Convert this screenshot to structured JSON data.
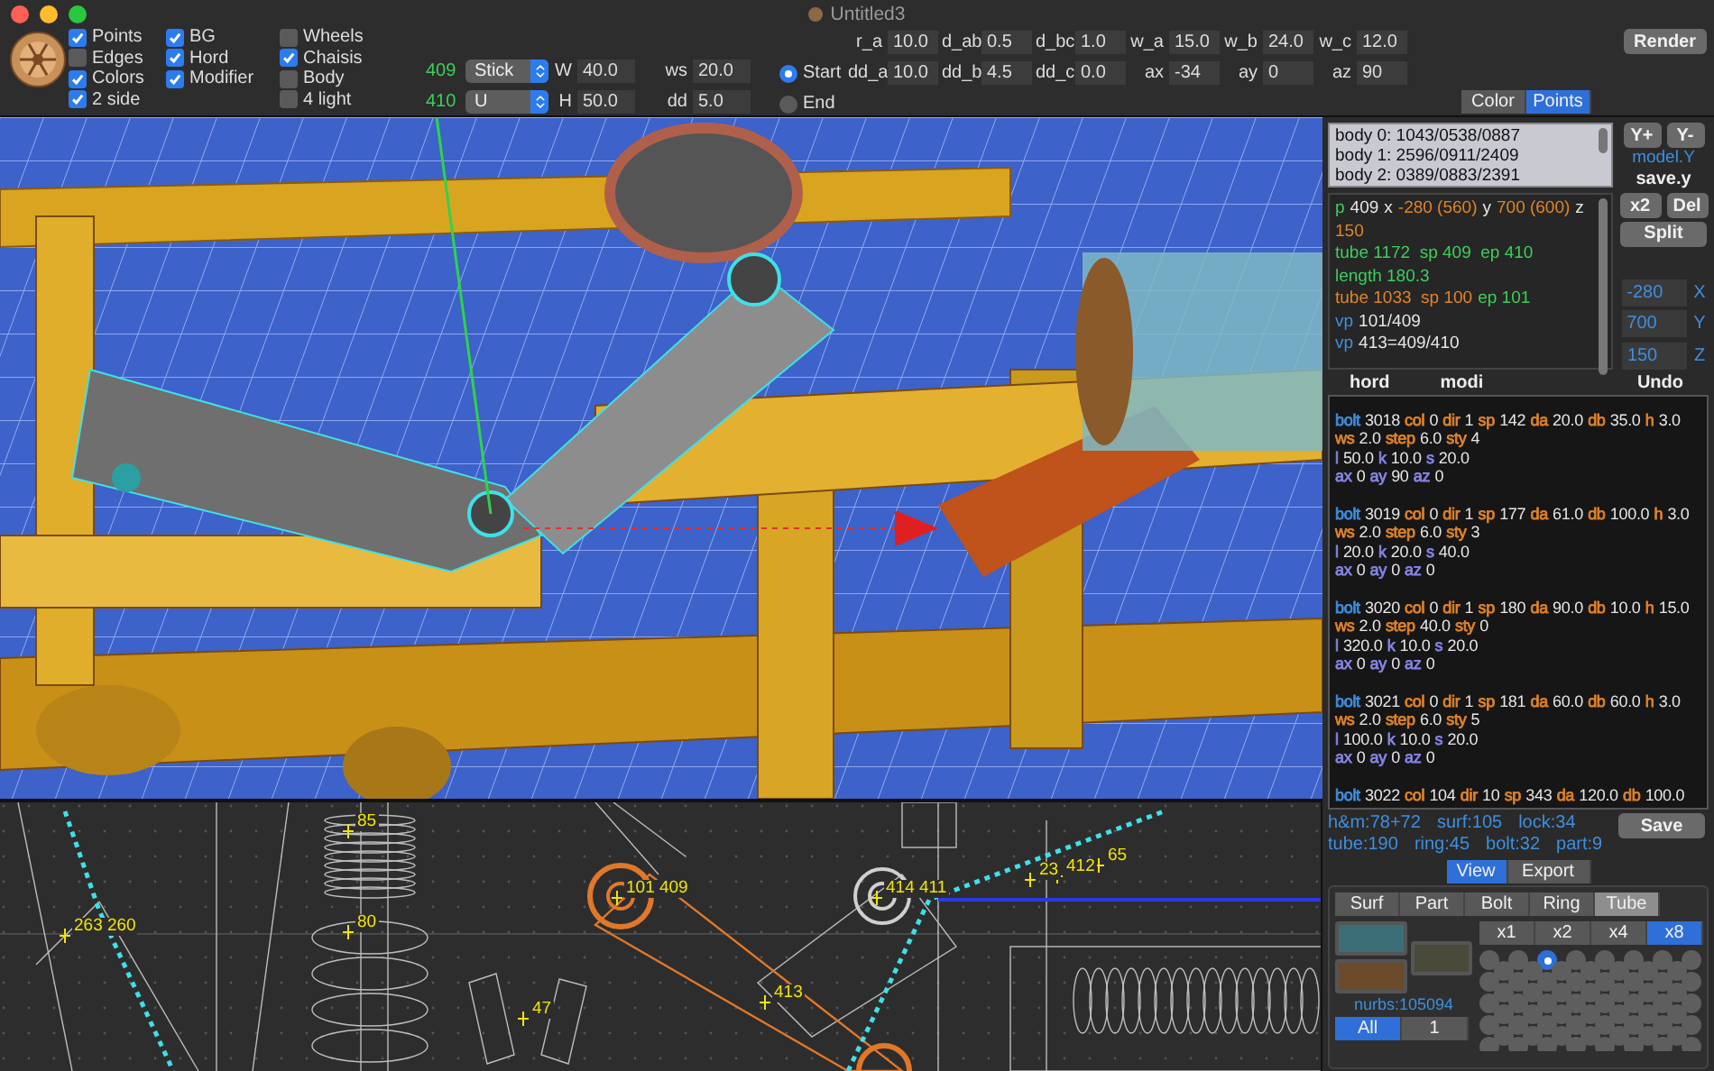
{
  "window": {
    "title": "Untitled3"
  },
  "toolbar": {
    "checkbox_columns": [
      [
        {
          "label": "Points",
          "checked": true
        },
        {
          "label": "Edges",
          "checked": false
        },
        {
          "label": "Colors",
          "checked": true
        },
        {
          "label": "2 side",
          "checked": true
        }
      ],
      [
        {
          "label": "BG",
          "checked": true
        },
        {
          "label": "Hord",
          "checked": true
        },
        {
          "label": "Modifier",
          "checked": true
        }
      ],
      [
        {
          "label": "Wheels",
          "checked": false
        },
        {
          "label": "Chaisis",
          "checked": true
        },
        {
          "label": "Body",
          "checked": false
        },
        {
          "label": "4 light",
          "checked": false
        }
      ]
    ],
    "element_rows": [
      {
        "id": "409",
        "type": "Stick",
        "dim_label": "W",
        "dim_value": "40.0",
        "extra_label": "ws",
        "extra_value": "20.0"
      },
      {
        "id": "410",
        "type": "U",
        "dim_label": "H",
        "dim_value": "50.0",
        "extra_label": "dd",
        "extra_value": "5.0"
      }
    ],
    "radios": [
      {
        "label": "Start",
        "selected": true
      },
      {
        "label": "End",
        "selected": false
      }
    ],
    "param_rows": [
      [
        {
          "label": "r_a",
          "value": "10.0"
        },
        {
          "label": "d_ab",
          "value": "0.5"
        },
        {
          "label": "d_bc",
          "value": "1.0"
        },
        {
          "label": "w_a",
          "value": "15.0"
        },
        {
          "label": "w_b",
          "value": "24.0"
        },
        {
          "label": "w_c",
          "value": "12.0"
        }
      ],
      [
        {
          "label": "dd_a",
          "value": "10.0"
        },
        {
          "label": "dd_b",
          "value": "4.5"
        },
        {
          "label": "dd_c",
          "value": "0.0"
        },
        {
          "label": "ax",
          "value": "-34"
        },
        {
          "label": "ay",
          "value": "0"
        },
        {
          "label": "az",
          "value": "90"
        }
      ]
    ],
    "render_button": "Render"
  },
  "wireframe": {
    "labels": [
      "263 260",
      "85",
      "80",
      "47",
      "101 409",
      "413",
      "414 411",
      "23",
      "412",
      "65"
    ]
  },
  "side_panel": {
    "mode_tabs": [
      {
        "label": "Color",
        "selected": false
      },
      {
        "label": "Points",
        "selected": true
      }
    ],
    "body_list": [
      "body 0: 1043/0538/0887",
      "body 1: 2596/0911/2409",
      "body 2: 0389/0883/2391"
    ],
    "y_buttons": [
      "Y+",
      "Y-"
    ],
    "model_link": "model.Y",
    "save_label": "save.y",
    "info_lines": [
      [
        {
          "t": "p",
          "color": "#3ccf5a"
        },
        {
          "t": "409",
          "color": "#e6e6e6"
        },
        {
          "t": "x",
          "color": "#e6e6e6"
        },
        {
          "t": "-280 (560)",
          "color": "#e0832a"
        },
        {
          "t": "y",
          "color": "#e6e6e6"
        },
        {
          "t": "700 (600)",
          "color": "#e0832a"
        },
        {
          "t": "z",
          "color": "#e6e6e6"
        }
      ],
      [
        {
          "t": "150",
          "color": "#e0832a"
        }
      ],
      [
        {
          "t": "tube 1172  sp 409  ep 410",
          "color": "#3ccf5a"
        }
      ],
      [
        {
          "t": "length 180.3",
          "color": "#3ccf5a"
        }
      ],
      [
        {
          "t": "tube 1033  sp 100",
          "color": "#e0832a"
        },
        {
          "t": "ep 101",
          "color": "#3ccf5a"
        }
      ],
      [
        {
          "t": "vp",
          "color": "#3d8fe0"
        },
        {
          "t": "101/409",
          "color": "#e6e6e6"
        }
      ],
      [
        {
          "t": "vp",
          "color": "#3d8fe0"
        },
        {
          "t": "413=409/410",
          "color": "#e6e6e6"
        }
      ]
    ],
    "edit_buttons": [
      "x2",
      "Del"
    ],
    "split_button": "Split",
    "coords": [
      {
        "value": "-280",
        "axis": "X"
      },
      {
        "value": "700",
        "axis": "Y"
      },
      {
        "value": "150",
        "axis": "Z"
      }
    ],
    "column_labels": [
      "hord",
      "modi"
    ],
    "undo_button": "Undo",
    "bolt_log": [
      [
        [
          {
            "key": "bolt",
            "value": "3018",
            "color": "#3d8fe0"
          },
          {
            "key": "col",
            "value": "0",
            "color": "#e0832a"
          },
          {
            "key": "dir",
            "value": "1",
            "color": "#e0832a"
          },
          {
            "key": "sp",
            "value": "142",
            "color": "#e0832a"
          },
          {
            "key": "da",
            "value": "20.0",
            "color": "#e0832a"
          },
          {
            "key": "db",
            "value": "35.0",
            "color": "#e0832a"
          },
          {
            "key": "h",
            "value": "3.0",
            "color": "#e0832a"
          }
        ],
        [
          {
            "key": "ws",
            "value": "2.0",
            "color": "#e0832a"
          },
          {
            "key": "step",
            "value": "6.0",
            "color": "#e0832a"
          },
          {
            "key": "sty",
            "value": "4",
            "color": "#e0832a"
          }
        ],
        [
          {
            "key": "l",
            "value": "50.0",
            "color": "#8585e6"
          },
          {
            "key": "k",
            "value": "10.0",
            "color": "#8585e6"
          },
          {
            "key": "s",
            "value": "20.0",
            "color": "#8585e6"
          }
        ],
        [
          {
            "key": "ax",
            "value": "0",
            "color": "#8585e6"
          },
          {
            "key": "ay",
            "value": "90",
            "color": "#8585e6"
          },
          {
            "key": "az",
            "value": "0",
            "color": "#8585e6"
          }
        ]
      ],
      [
        [
          {
            "key": "bolt",
            "value": "3019",
            "color": "#3d8fe0"
          },
          {
            "key": "col",
            "value": "0",
            "color": "#e0832a"
          },
          {
            "key": "dir",
            "value": "1",
            "color": "#e0832a"
          },
          {
            "key": "sp",
            "value": "177",
            "color": "#e0832a"
          },
          {
            "key": "da",
            "value": "61.0",
            "color": "#e0832a"
          },
          {
            "key": "db",
            "value": "100.0",
            "color": "#e0832a"
          },
          {
            "key": "h",
            "value": "3.0",
            "color": "#e0832a"
          }
        ],
        [
          {
            "key": "ws",
            "value": "2.0",
            "color": "#e0832a"
          },
          {
            "key": "step",
            "value": "6.0",
            "color": "#e0832a"
          },
          {
            "key": "sty",
            "value": "3",
            "color": "#e0832a"
          }
        ],
        [
          {
            "key": "l",
            "value": "20.0",
            "color": "#8585e6"
          },
          {
            "key": "k",
            "value": "20.0",
            "color": "#8585e6"
          },
          {
            "key": "s",
            "value": "40.0",
            "color": "#8585e6"
          }
        ],
        [
          {
            "key": "ax",
            "value": "0",
            "color": "#8585e6"
          },
          {
            "key": "ay",
            "value": "0",
            "color": "#8585e6"
          },
          {
            "key": "az",
            "value": "0",
            "color": "#8585e6"
          }
        ]
      ],
      [
        [
          {
            "key": "bolt",
            "value": "3020",
            "color": "#3d8fe0"
          },
          {
            "key": "col",
            "value": "0",
            "color": "#e0832a"
          },
          {
            "key": "dir",
            "value": "1",
            "color": "#e0832a"
          },
          {
            "key": "sp",
            "value": "180",
            "color": "#e0832a"
          },
          {
            "key": "da",
            "value": "90.0",
            "color": "#e0832a"
          },
          {
            "key": "db",
            "value": "10.0",
            "color": "#e0832a"
          },
          {
            "key": "h",
            "value": "15.0",
            "color": "#e0832a"
          }
        ],
        [
          {
            "key": "ws",
            "value": "2.0",
            "color": "#e0832a"
          },
          {
            "key": "step",
            "value": "40.0",
            "color": "#e0832a"
          },
          {
            "key": "sty",
            "value": "0",
            "color": "#e0832a"
          }
        ],
        [
          {
            "key": "l",
            "value": "320.0",
            "color": "#8585e6"
          },
          {
            "key": "k",
            "value": "10.0",
            "color": "#8585e6"
          },
          {
            "key": "s",
            "value": "20.0",
            "color": "#8585e6"
          }
        ],
        [
          {
            "key": "ax",
            "value": "0",
            "color": "#8585e6"
          },
          {
            "key": "ay",
            "value": "0",
            "color": "#8585e6"
          },
          {
            "key": "az",
            "value": "0",
            "color": "#8585e6"
          }
        ]
      ],
      [
        [
          {
            "key": "bolt",
            "value": "3021",
            "color": "#3d8fe0"
          },
          {
            "key": "col",
            "value": "0",
            "color": "#e0832a"
          },
          {
            "key": "dir",
            "value": "1",
            "color": "#e0832a"
          },
          {
            "key": "sp",
            "value": "181",
            "color": "#e0832a"
          },
          {
            "key": "da",
            "value": "60.0",
            "color": "#e0832a"
          },
          {
            "key": "db",
            "value": "60.0",
            "color": "#e0832a"
          },
          {
            "key": "h",
            "value": "3.0",
            "color": "#e0832a"
          }
        ],
        [
          {
            "key": "ws",
            "value": "2.0",
            "color": "#e0832a"
          },
          {
            "key": "step",
            "value": "6.0",
            "color": "#e0832a"
          },
          {
            "key": "sty",
            "value": "5",
            "color": "#e0832a"
          }
        ],
        [
          {
            "key": "l",
            "value": "100.0",
            "color": "#8585e6"
          },
          {
            "key": "k",
            "value": "10.0",
            "color": "#8585e6"
          },
          {
            "key": "s",
            "value": "20.0",
            "color": "#8585e6"
          }
        ],
        [
          {
            "key": "ax",
            "value": "0",
            "color": "#8585e6"
          },
          {
            "key": "ay",
            "value": "0",
            "color": "#8585e6"
          },
          {
            "key": "az",
            "value": "0",
            "color": "#8585e6"
          }
        ]
      ],
      [
        [
          {
            "key": "bolt",
            "value": "3022",
            "color": "#3d8fe0"
          },
          {
            "key": "col",
            "value": "104",
            "color": "#e0832a"
          },
          {
            "key": "dir",
            "value": "10",
            "color": "#e0832a"
          },
          {
            "key": "sp",
            "value": "343",
            "color": "#e0832a"
          },
          {
            "key": "da",
            "value": "120.0",
            "color": "#e0832a"
          },
          {
            "key": "db",
            "value": "100.0",
            "color": "#e0832a"
          }
        ]
      ]
    ],
    "stats": [
      [
        "h&m:78+72",
        "surf:105",
        "lock:34"
      ],
      [
        "tube:190",
        "ring:45",
        "bolt:32",
        "part:9"
      ]
    ],
    "save_button": "Save",
    "view_tabs": [
      {
        "label": "View",
        "selected": true
      },
      {
        "label": "Export",
        "selected": false
      }
    ],
    "object_tabs": [
      {
        "label": "Surf",
        "selected": false
      },
      {
        "label": "Part",
        "selected": false
      },
      {
        "label": "Bolt",
        "selected": false
      },
      {
        "label": "Ring",
        "selected": false
      },
      {
        "label": "Tube",
        "selected": true
      }
    ],
    "nurbs": "nurbs:105094",
    "scope_tabs": [
      {
        "label": "All",
        "selected": true
      },
      {
        "label": "1",
        "selected": false
      }
    ],
    "zoom_tabs": [
      {
        "label": "x1",
        "selected": false
      },
      {
        "label": "x2",
        "selected": false
      },
      {
        "label": "x4",
        "selected": false
      },
      {
        "label": "x8",
        "selected": true
      }
    ],
    "dot_rows": [
      [
        {
          "selected": false
        },
        {
          "selected": false
        },
        {
          "selected": true
        },
        {
          "selected": false
        },
        {
          "selected": false
        },
        {
          "selected": false
        },
        {
          "selected": false
        },
        {
          "selected": false
        }
      ],
      [
        {
          "selected": false
        },
        {
          "selected": false
        },
        {
          "selected": false
        },
        {
          "selected": false
        },
        {
          "selected": false
        },
        {
          "selected": false
        },
        {
          "selected": false
        }
      ],
      [
        {
          "selected": false
        },
        {
          "selected": false
        },
        {
          "selected": false
        },
        {
          "selected": false
        },
        {
          "selected": false
        },
        {
          "selected": false
        },
        {
          "selected": false
        },
        {
          "selected": false
        }
      ],
      [
        {
          "selected": false
        },
        {
          "selected": false
        },
        {
          "selected": false
        },
        {
          "selected": false
        },
        {
          "selected": false
        },
        {
          "selected": false
        },
        {
          "selected": false
        }
      ],
      [
        {
          "selected": false
        },
        {
          "selected": false
        },
        {
          "selected": false
        },
        {
          "selected": false
        },
        {
          "selected": false
        },
        {
          "selected": false
        },
        {
          "selected": false
        },
        {
          "selected": false
        }
      ],
      [
        {
          "selected": false
        },
        {
          "selected": false
        },
        {
          "selected": false
        },
        {
          "selected": false
        },
        {
          "selected": false
        },
        {
          "selected": false
        },
        {
          "selected": false
        }
      ],
      [
        {
          "selected": false
        },
        {
          "selected": false
        },
        {
          "selected": false
        },
        {
          "selected": false
        },
        {
          "selected": false
        },
        {
          "selected": false
        },
        {
          "selected": false
        },
        {
          "selected": false
        }
      ],
      [
        {
          "selected": false
        },
        {
          "selected": false
        },
        {
          "selected": false
        },
        {
          "selected": false
        },
        {
          "selected": false
        },
        {
          "selected": false
        },
        {
          "selected": false
        }
      ],
      [
        {
          "selected": false
        },
        {
          "selected": false
        },
        {
          "selected": false
        },
        {
          "selected": false
        },
        {
          "selected": false
        },
        {
          "selected": false
        },
        {
          "selected": false
        },
        {
          "selected": false
        }
      ]
    ]
  }
}
